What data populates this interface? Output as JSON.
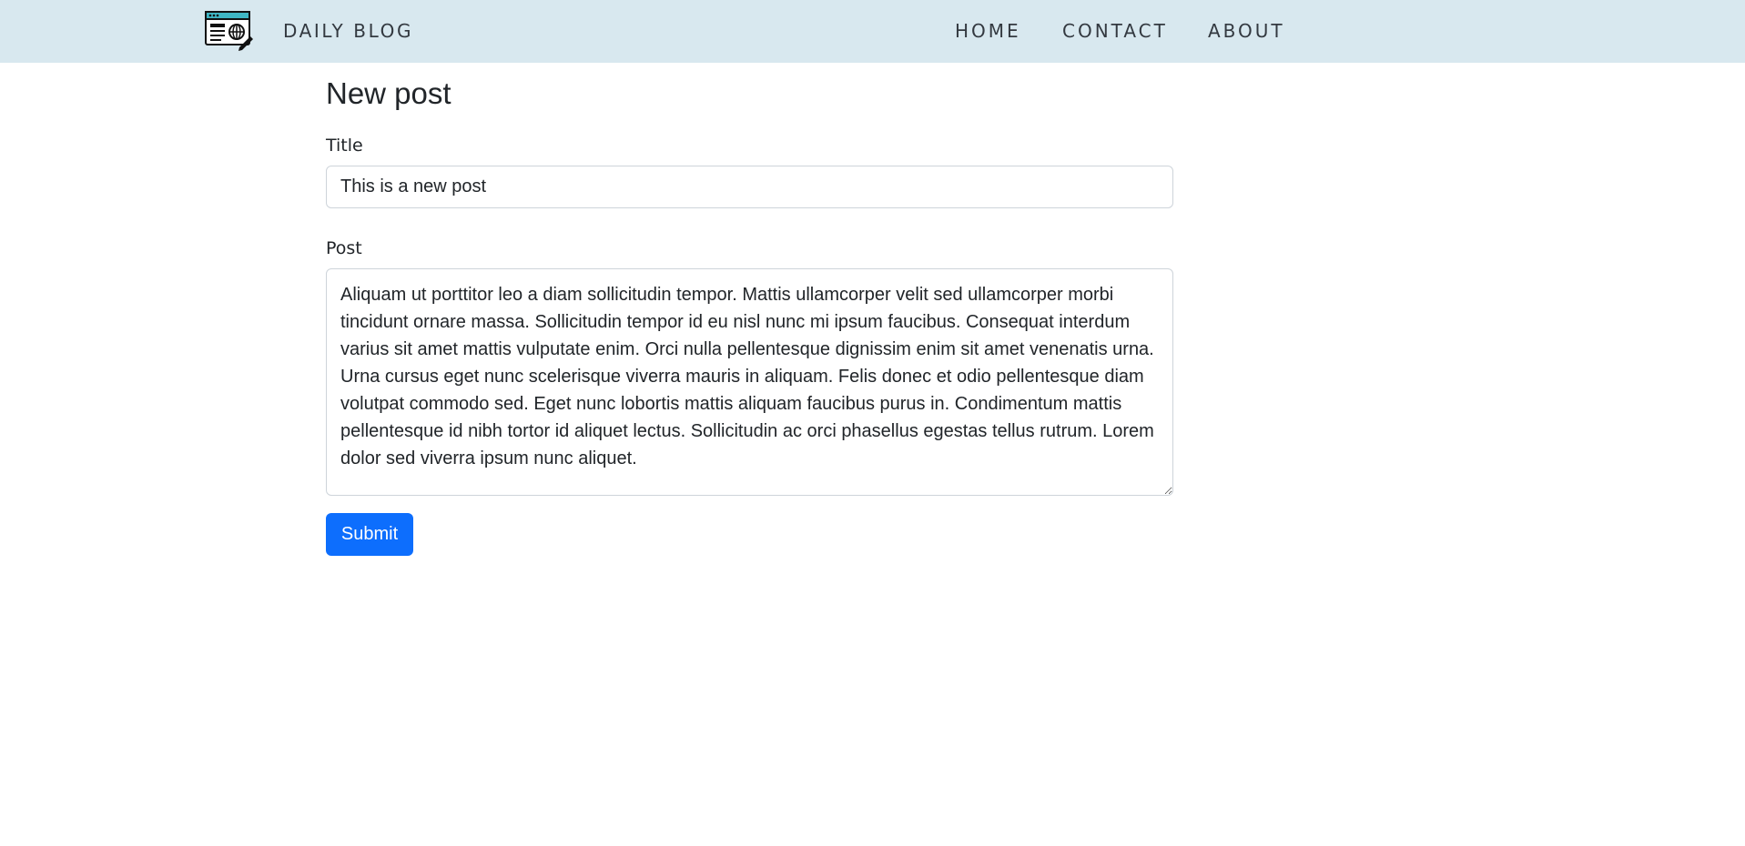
{
  "navbar": {
    "brand": "DAILY BLOG",
    "logo_icon": "blog-browser-icon",
    "links": {
      "home": "HOME",
      "contact": "CONTACT",
      "about": "ABOUT"
    }
  },
  "form": {
    "heading": "New post",
    "title_label": "Title",
    "title_value": "This is a new post",
    "post_label": "Post",
    "post_value": "Aliquam ut porttitor leo a diam sollicitudin tempor. Mattis ullamcorper velit sed ullamcorper morbi tincidunt ornare massa. Sollicitudin tempor id eu nisl nunc mi ipsum faucibus. Consequat interdum varius sit amet mattis vulputate enim. Orci nulla pellentesque dignissim enim sit amet venenatis urna. Urna cursus eget nunc scelerisque viverra mauris in aliquam. Felis donec et odio pellentesque diam volutpat commodo sed. Eget nunc lobortis mattis aliquam faucibus purus in. Condimentum mattis pellentesque id nibh tortor id aliquet lectus. Sollicitudin ac orci phasellus egestas tellus rutrum. Lorem dolor sed viverra ipsum nunc aliquet.",
    "submit_label": "Submit"
  },
  "colors": {
    "navbar_bg": "#d8e8ef",
    "button_bg": "#0d6efd",
    "text": "#212529"
  }
}
